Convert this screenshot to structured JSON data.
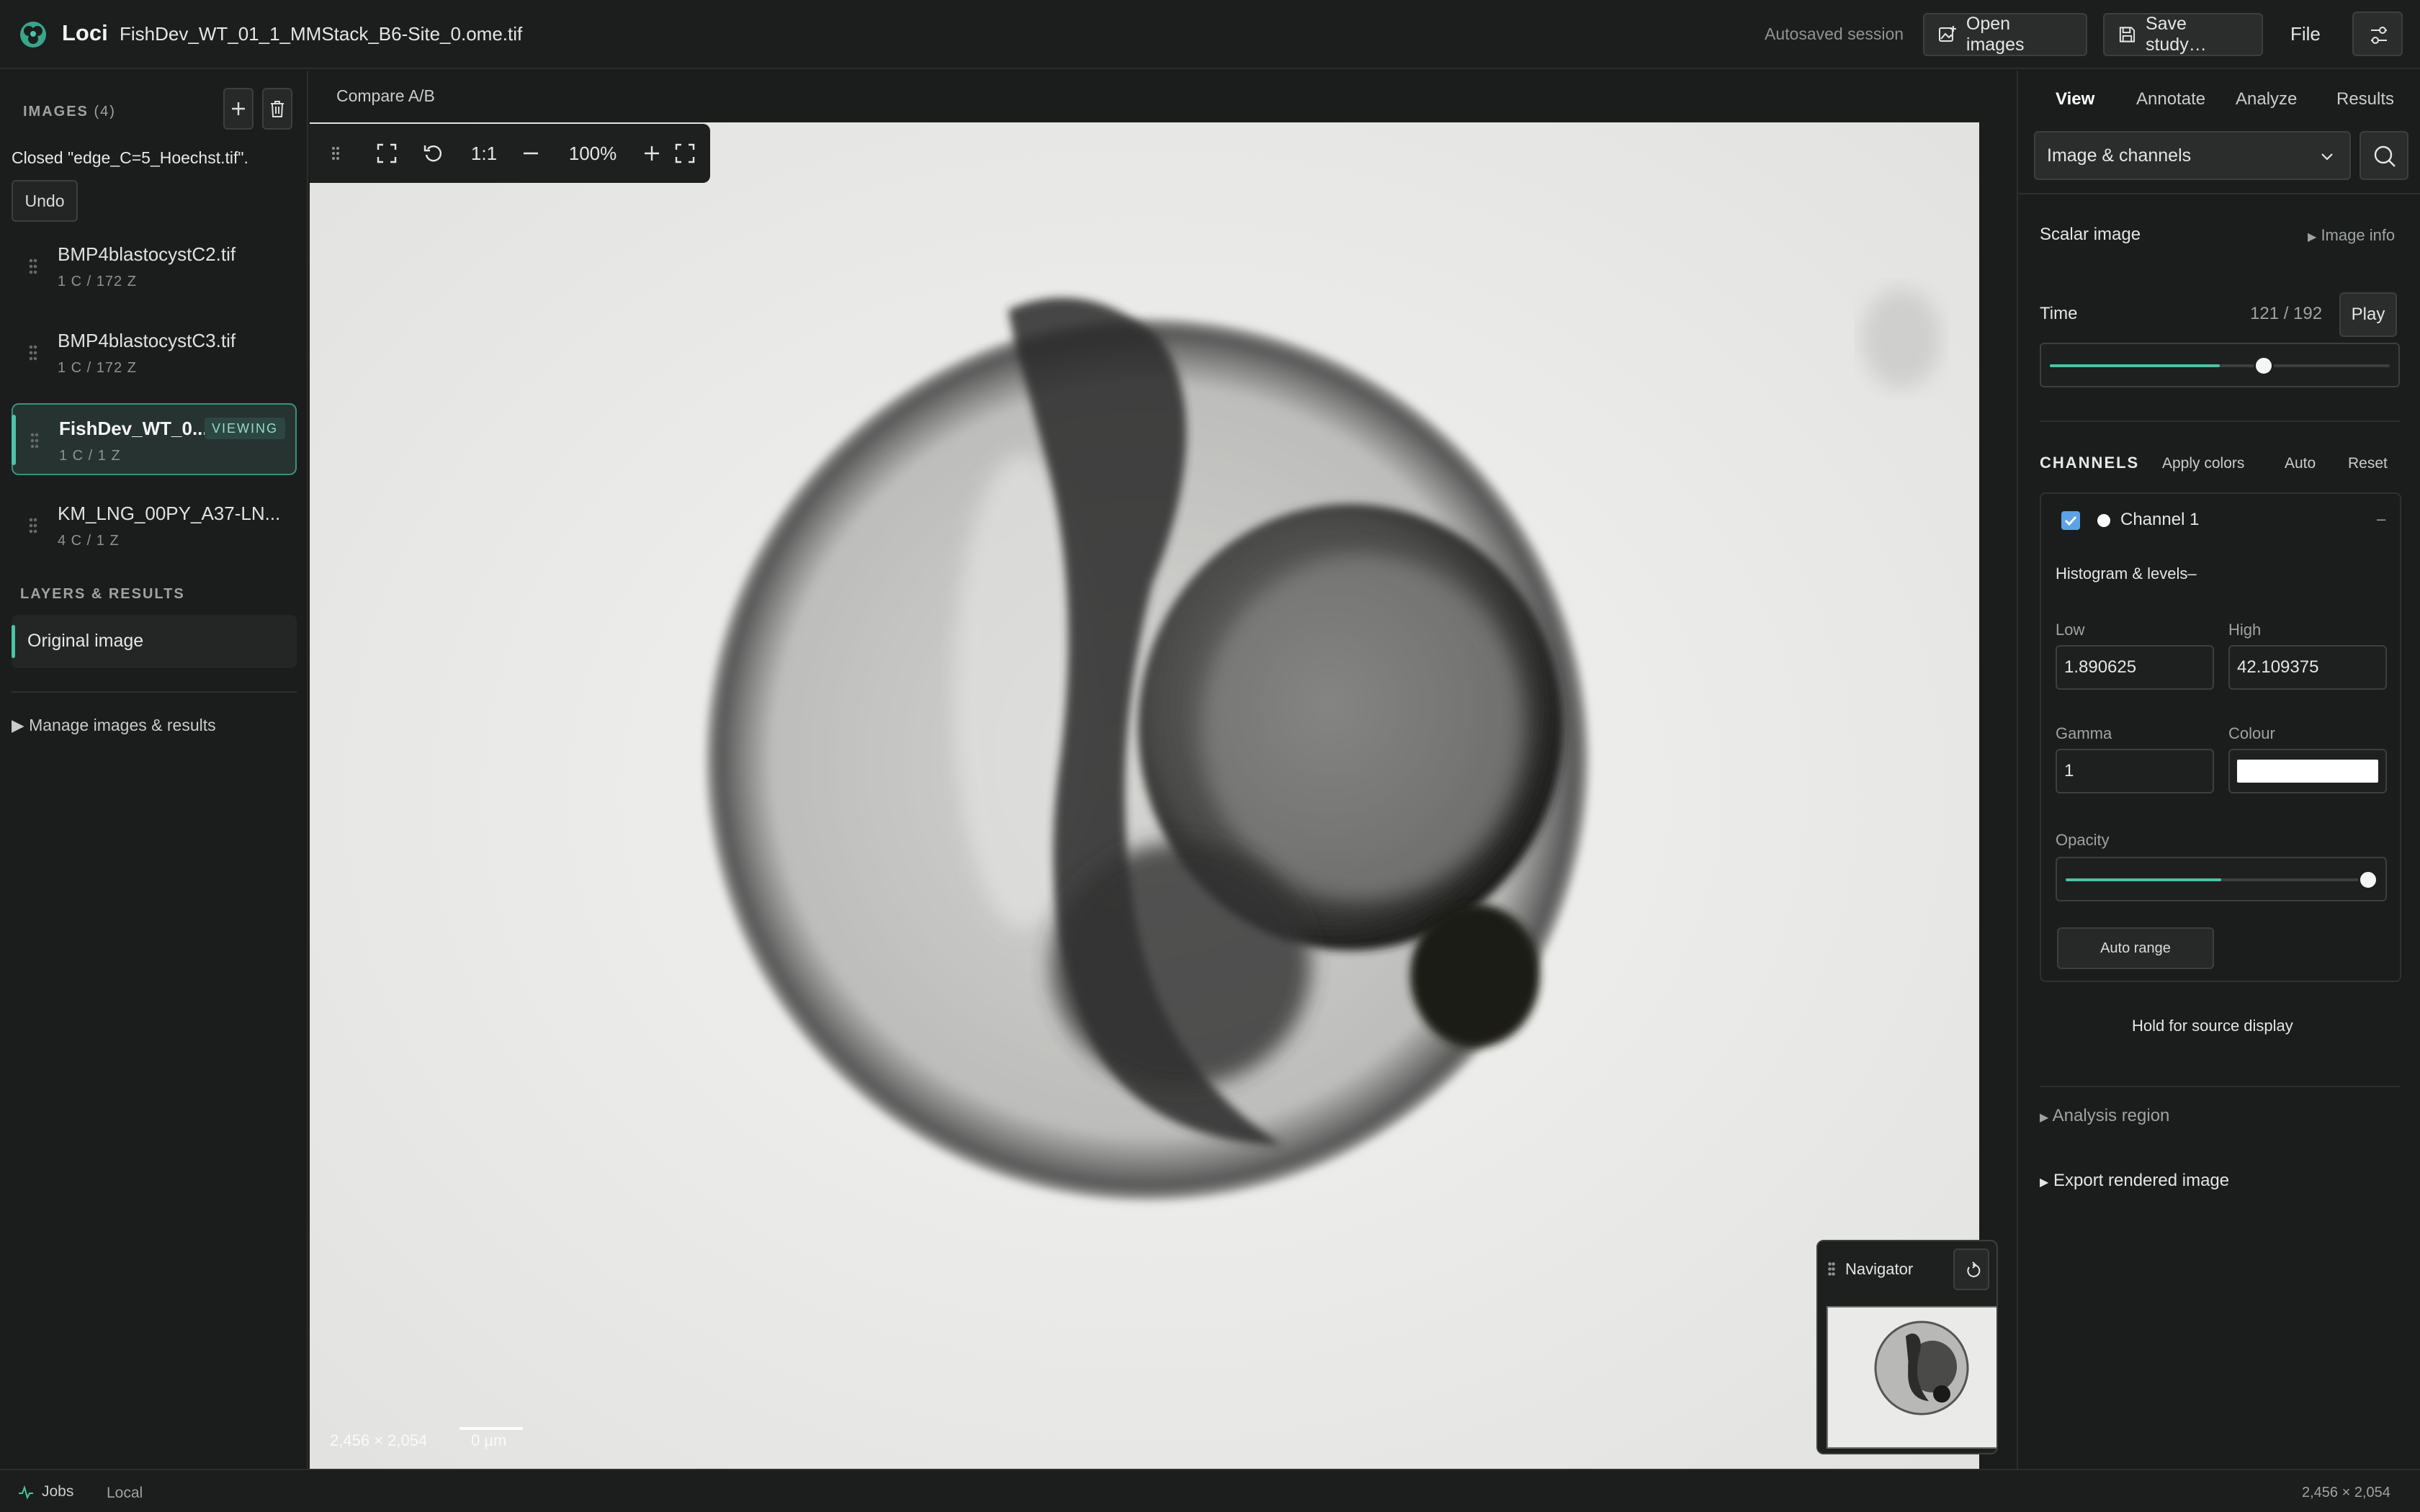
{
  "app": {
    "name": "Loci",
    "filename": "FishDev_WT_01_1_MMStack_B6-Site_0.ome.tif"
  },
  "header": {
    "autosave": "Autosaved session",
    "open_images": "Open images",
    "save_study": "Save study…",
    "file": "File"
  },
  "sidebar": {
    "images_label": "IMAGES",
    "images_count": "(4)",
    "closed_message": "Closed \"edge_C=5_Hoechst.tif\".",
    "undo": "Undo",
    "images": [
      {
        "name": "BMP4blastocystC2.tif",
        "meta": "1 C / 172 Z"
      },
      {
        "name": "BMP4blastocystC3.tif",
        "meta": "1 C / 172 Z"
      },
      {
        "name": "FishDev_WT_0...",
        "meta": "1 C / 1 Z",
        "badge": "VIEWING"
      },
      {
        "name": "KM_LNG_00PY_A37-LN...",
        "meta": "4 C / 1 Z"
      }
    ],
    "layers_label": "LAYERS & RESULTS",
    "layer": "Original image",
    "manage": "Manage images & results"
  },
  "viewer": {
    "compare": "Compare A/B",
    "toolbar": {
      "ratio": "1:1",
      "zoom": "100%"
    },
    "dims": "2,456 × 2,054",
    "scale": "0 µm",
    "navigator": "Navigator"
  },
  "right": {
    "tabs": [
      "View",
      "Annotate",
      "Analyze",
      "Results"
    ],
    "select": "Image & channels",
    "scalar": "Scalar image",
    "image_info": "Image info",
    "time_label": "Time",
    "time_value": "121 / 192",
    "play": "Play",
    "time_fraction": 0.63,
    "channels_label": "CHANNELS",
    "apply_colors": "Apply colors",
    "auto": "Auto",
    "reset": "Reset",
    "channel": {
      "name": "Channel 1",
      "collapse": "–",
      "histogram": "Histogram & levels–",
      "low_label": "Low",
      "low": "1.890625",
      "high_label": "High",
      "high": "42.109375",
      "gamma_label": "Gamma",
      "gamma": "1",
      "colour_label": "Colour",
      "colour": "#ffffff",
      "opacity_label": "Opacity",
      "opacity": 1.0,
      "auto_range": "Auto range"
    },
    "hold": "Hold for source display",
    "analysis": "Analysis region",
    "export": "Export rendered image"
  },
  "status": {
    "jobs": "Jobs",
    "local": "Local",
    "dims": "2,456 × 2,054"
  },
  "colors": {
    "accent": "#4cc3a6",
    "checkbox": "#5ea2e6"
  }
}
